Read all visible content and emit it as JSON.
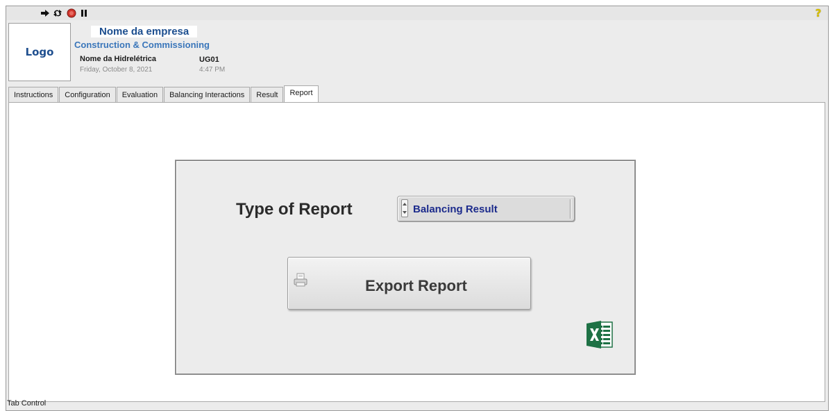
{
  "toolbar": {
    "icons": [
      "run-arrow-icon",
      "run-continuous-icon",
      "abort-icon",
      "pause-icon",
      "context-help-icon"
    ],
    "help_glyph": "?"
  },
  "header": {
    "logo": "Logo",
    "company_name": "Nome da empresa",
    "company_subtitle": "Construction & Commissioning",
    "plant_name": "Nome da Hidrelétrica",
    "date": "Friday, October 8, 2021",
    "unit": "UG01",
    "time": "4:47 PM"
  },
  "tabs": [
    {
      "label": "Instructions"
    },
    {
      "label": "Configuration"
    },
    {
      "label": "Evaluation"
    },
    {
      "label": "Balancing Interactions"
    },
    {
      "label": "Result"
    },
    {
      "label": "Report",
      "active": true
    }
  ],
  "report": {
    "type_label": "Type of Report",
    "type_value": "Balancing Result",
    "export_label": "Export Report"
  },
  "tab_control_caption": "Tab Control",
  "colors": {
    "company_name": "#1c4e8f",
    "company_subtitle": "#3a76ba",
    "ring_text": "#1c2b8c",
    "excel_green": "#1e7145",
    "abort_red": "#d0342c"
  }
}
